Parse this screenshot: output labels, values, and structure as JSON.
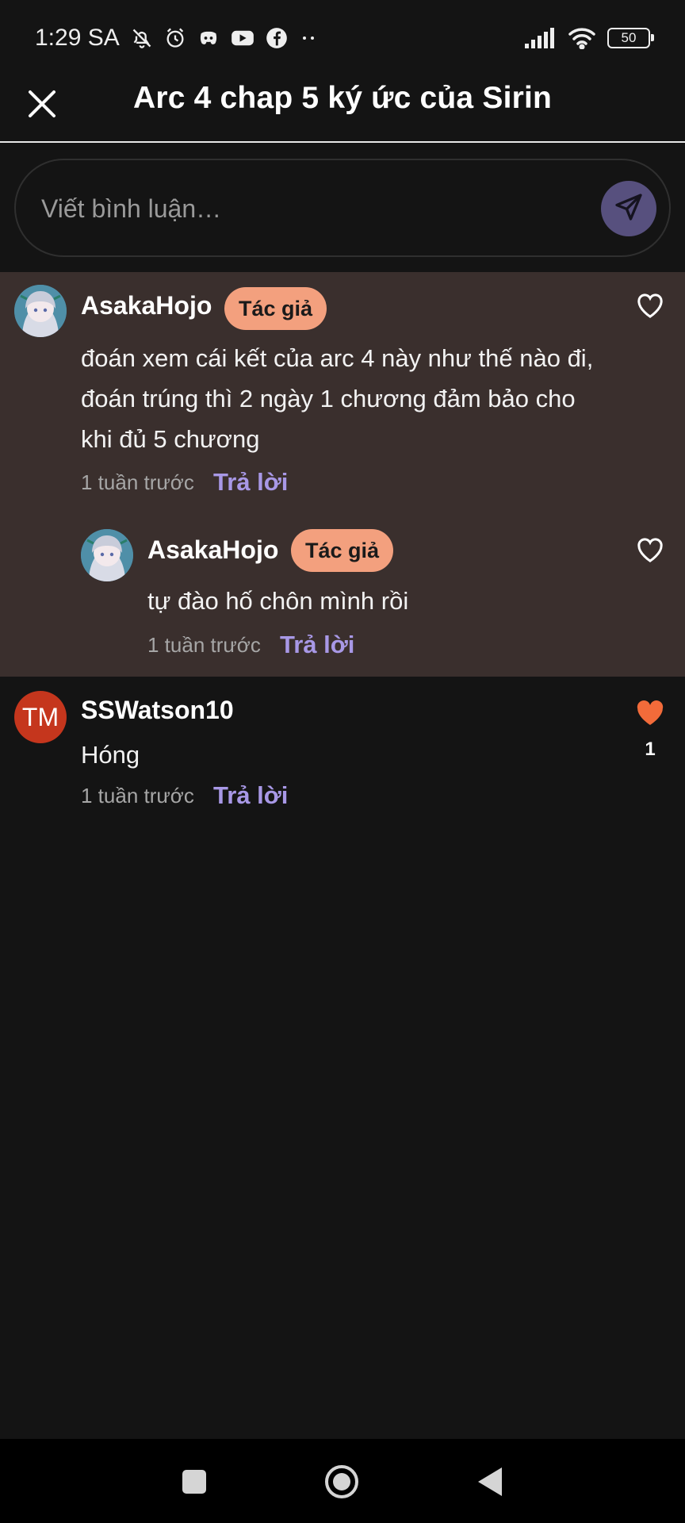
{
  "status_bar": {
    "time": "1:29 SA",
    "battery": "50",
    "icons": [
      "bell-off-icon",
      "alarm-icon",
      "discord-icon",
      "youtube-icon",
      "facebook-icon",
      "more-dots-icon",
      "signal-icon",
      "wifi-icon",
      "battery-icon"
    ]
  },
  "header": {
    "title": "Arc 4 chap 5 ký ức của Sirin"
  },
  "composer": {
    "placeholder": "Viết bình luận…"
  },
  "comments": [
    {
      "username": "AsakaHojo",
      "badge": "Tác giả",
      "text": "đoán xem cái kết của arc 4 này như thế nào đi, đoán trúng thì 2 ngày 1 chương đảm bảo cho khi đủ 5 chương",
      "time": "1 tuần trước",
      "reply_label": "Trả lời",
      "liked": false,
      "replies": [
        {
          "username": "AsakaHojo",
          "badge": "Tác giả",
          "text": "tự đào hố chôn mình rồi",
          "time": "1 tuần trước",
          "reply_label": "Trả lời",
          "liked": false
        }
      ]
    },
    {
      "username": "SSWatson10",
      "avatar_initials": "TM",
      "text": "Hóng",
      "time": "1 tuần trước",
      "reply_label": "Trả lời",
      "liked": true,
      "like_count": "1"
    }
  ],
  "colors": {
    "background": "#141414",
    "thread_highlight": "#3a2f2d",
    "badge": "#f3a07e",
    "reply_link": "#a898e6",
    "heart_liked": "#f26b3a",
    "send_button": "#57507e",
    "avatar_tm": "#c5361d"
  }
}
